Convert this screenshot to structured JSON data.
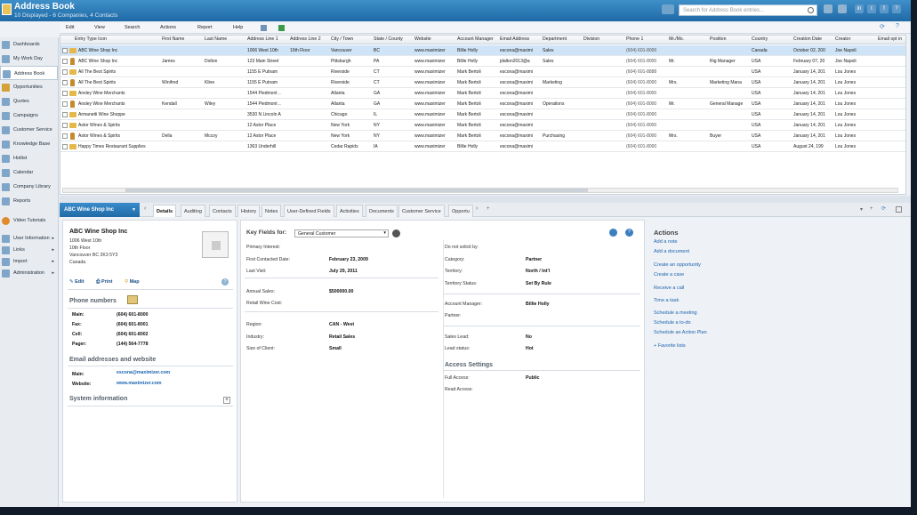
{
  "header": {
    "title": "Address Book",
    "subtitle": "10 Displayed - 6 Companies, 4 Contacts",
    "search_placeholder": "Search for Address Book entries..."
  },
  "sidebar": {
    "items": [
      "Dashboards",
      "My Work Day",
      "Address Book",
      "Opportunities",
      "Quotes",
      "Campaigns",
      "Customer Service",
      "Knowledge Base",
      "Hotlist",
      "Calendar",
      "Company Library",
      "Reports"
    ],
    "active": "Address Book",
    "video": "Video Tutorials",
    "bottom": [
      "User Information",
      "Links",
      "Import",
      "Administration"
    ]
  },
  "toolbar": {
    "menus": [
      "Edit",
      "View",
      "Search",
      "Actions",
      "Report",
      "Help"
    ]
  },
  "grid": {
    "columns": [
      "Entry Type Icon",
      "First Name",
      "Last Name",
      "Address Line 1",
      "Address Line 2",
      "City / Town",
      "State / County",
      "Website",
      "Account Manager",
      "Email Address",
      "Department",
      "Division",
      "Phone 1",
      "Mr./Ms.",
      "Position",
      "Country",
      "Creation Date",
      "Creator",
      "Email opt in"
    ],
    "rows": [
      {
        "name": "ABC Wine Shop Inc",
        "first": "",
        "last": "",
        "addr1": "1006 West 10th",
        "addr2": "10th Floor",
        "city": "Vancouver",
        "state": "BC",
        "web": "www.maximizer",
        "mgr": "Billie Holly",
        "email": "escona@maximi",
        "dept": "Sales",
        "phone": "(604) 601-8000",
        "mr": "",
        "pos": "",
        "country": "Canada",
        "created": "October 02, 200",
        "creator": "Joe Napoli",
        "type": "company"
      },
      {
        "name": "ABC Wine Shop Inc",
        "first": "James",
        "last": "Dolton",
        "addr1": "123 Main Street",
        "addr2": "",
        "city": "Pittsburgh",
        "state": "PA",
        "web": "www.maximizer",
        "mgr": "Billie Holly",
        "email": "jdalton2013@a",
        "dept": "Sales",
        "phone": "(604) 601-8000",
        "mr": "Mr.",
        "pos": "Rig Manager",
        "country": "USA",
        "created": "February 07, 20",
        "creator": "Joe Napoli",
        "type": "contact"
      },
      {
        "name": "All The Best Spirits",
        "first": "",
        "last": "",
        "addr1": "1155 E Putnam",
        "addr2": "",
        "city": "Riverside",
        "state": "CT",
        "web": "www.maximizer",
        "mgr": "Mark Bertoli",
        "email": "escona@maximi",
        "dept": "",
        "phone": "(604) 601-8888",
        "mr": "",
        "pos": "",
        "country": "USA",
        "created": "January 14, 201",
        "creator": "Lou Jones",
        "type": "company"
      },
      {
        "name": "All The Best Spirits",
        "first": "Winifred",
        "last": "Kline",
        "addr1": "1155 E Putnam",
        "addr2": "",
        "city": "Riverside",
        "state": "CT",
        "web": "www.maximizer",
        "mgr": "Mark Bertoli",
        "email": "escona@maximi",
        "dept": "Marketing",
        "phone": "(604) 601-8000",
        "mr": "Mrs.",
        "pos": "Marketing Mana",
        "country": "USA",
        "created": "January 14, 201",
        "creator": "Lou Jones",
        "type": "contact"
      },
      {
        "name": "Ansley Wine Merchants",
        "first": "",
        "last": "",
        "addr1": "1544 Piedmont ..",
        "addr2": "",
        "city": "Atlanta",
        "state": "GA",
        "web": "www.maximizer",
        "mgr": "Mark Bertoli",
        "email": "escona@maximi",
        "dept": "",
        "phone": "(604) 601-8000",
        "mr": "",
        "pos": "",
        "country": "USA",
        "created": "January 14, 201",
        "creator": "Lou Jones",
        "type": "company"
      },
      {
        "name": "Ansley Wine Merchants",
        "first": "Kendall",
        "last": "Wiley",
        "addr1": "1544 Piedmont ..",
        "addr2": "",
        "city": "Atlanta",
        "state": "GA",
        "web": "www.maximizer",
        "mgr": "Mark Bertoli",
        "email": "escona@maximi",
        "dept": "Operations",
        "phone": "(604) 601-8000",
        "mr": "Mr.",
        "pos": "General Manage",
        "country": "USA",
        "created": "January 14, 201",
        "creator": "Lou Jones",
        "type": "contact"
      },
      {
        "name": "Armanetti Wine Shoppe",
        "first": "",
        "last": "",
        "addr1": "3530 N Lincoln A",
        "addr2": "",
        "city": "Chicago",
        "state": "IL",
        "web": "www.maximizer",
        "mgr": "Mark Bertoli",
        "email": "escona@maximi",
        "dept": "",
        "phone": "(604) 601-8000",
        "mr": "",
        "pos": "",
        "country": "USA",
        "created": "January 14, 201",
        "creator": "Lou Jones",
        "type": "company"
      },
      {
        "name": "Astor Wines & Spirits",
        "first": "",
        "last": "",
        "addr1": "12 Astor Place",
        "addr2": "",
        "city": "New York",
        "state": "NY",
        "web": "www.maximizer",
        "mgr": "Mark Bertoli",
        "email": "escona@maximi",
        "dept": "",
        "phone": "(604) 601-8000",
        "mr": "",
        "pos": "",
        "country": "USA",
        "created": "January 14, 201",
        "creator": "Lou Jones",
        "type": "company"
      },
      {
        "name": "Astor Wines & Spirits",
        "first": "Della",
        "last": "Mccoy",
        "addr1": "12 Astor Place",
        "addr2": "",
        "city": "New York",
        "state": "NY",
        "web": "www.maximizer",
        "mgr": "Mark Bertoli",
        "email": "escona@maximi",
        "dept": "Purchasing",
        "phone": "(604) 601-8000",
        "mr": "Mrs.",
        "pos": "Buyer",
        "country": "USA",
        "created": "January 14, 201",
        "creator": "Lou Jones",
        "type": "contact"
      },
      {
        "name": "Happy Times Restaurant Supplies",
        "first": "",
        "last": "",
        "addr1": "1363 Underhill",
        "addr2": "",
        "city": "Cedar Rapids",
        "state": "IA",
        "web": "www.maximizer",
        "mgr": "Billie Holly",
        "email": "escona@maximi",
        "dept": "",
        "phone": "(604) 601-8000",
        "mr": "",
        "pos": "",
        "country": "USA",
        "created": "August 24, 199",
        "creator": "Lou Jones",
        "type": "company"
      }
    ]
  },
  "detail": {
    "title": "ABC Wine Shop Inc",
    "tabs": [
      "Details",
      "Auditing",
      "Contacts",
      "History",
      "Notes",
      "User-Defined Fields",
      "Activities",
      "Documents",
      "Customer Service",
      "Opportu"
    ],
    "company": "ABC Wine Shop Inc",
    "address": [
      "1006 West 10th",
      "10th Floor",
      "Vancouver BC 2K3 5Y3",
      "Canada"
    ],
    "actions": [
      "Edit",
      "Print",
      "Map"
    ],
    "phones_title": "Phone numbers",
    "phones": [
      {
        "label": "Main:",
        "value": "(604) 601-8000"
      },
      {
        "label": "Fax:",
        "value": "(604) 601-8001"
      },
      {
        "label": "Cell:",
        "value": "(604) 601-8002"
      },
      {
        "label": "Pager:",
        "value": "(144) 564-7778"
      }
    ],
    "email_title": "Email addresses and website",
    "emails": [
      {
        "label": "Main:",
        "value": "escona@maximizer.com"
      },
      {
        "label": "Website:",
        "value": "www.maximizer.com"
      }
    ],
    "sysinfo": "System information",
    "keyfields_label": "Key Fields for:",
    "keyfields_value": "General Customer",
    "fields_left": [
      {
        "label": "Primary Interest:",
        "value": ""
      },
      {
        "label": "First Contacted Date:",
        "value": "February 23, 2009"
      },
      {
        "label": "Last Visit:",
        "value": "July 29, 2011"
      },
      {
        "label": "Annual Sales:",
        "value": "$500000.00"
      },
      {
        "label": "Retail Wine Cost:",
        "value": ""
      },
      {
        "label": "Region:",
        "value": "CAN - West"
      },
      {
        "label": "Industry:",
        "value": "Retail Sales"
      },
      {
        "label": "Size of Client:",
        "value": "Small"
      }
    ],
    "fields_right": [
      {
        "label": "Do not solicit by:",
        "value": ""
      },
      {
        "label": "Category:",
        "value": "Partner"
      },
      {
        "label": "Territory:",
        "value": "North / Int'l"
      },
      {
        "label": "Territory Status:",
        "value": "Set By Rule"
      },
      {
        "label": "Account Manager:",
        "value": "Billie Holly"
      },
      {
        "label": "Partner:",
        "value": ""
      },
      {
        "label": "Sales Lead:",
        "value": "No"
      },
      {
        "label": "Lead status:",
        "value": "Hot"
      }
    ],
    "access_title": "Access Settings",
    "access": [
      {
        "label": "Full Access:",
        "value": "Public"
      },
      {
        "label": "Read Access:",
        "value": ""
      }
    ],
    "actions_title": "Actions",
    "action_links": [
      "Add a note",
      "Add a document",
      "Create an opportunity",
      "Create a case",
      "Receive a call",
      "Time a task",
      "Schedule a meeting",
      "Schedule a to-do",
      "Schedule an Action Plan",
      "+ Favorite lists"
    ]
  }
}
